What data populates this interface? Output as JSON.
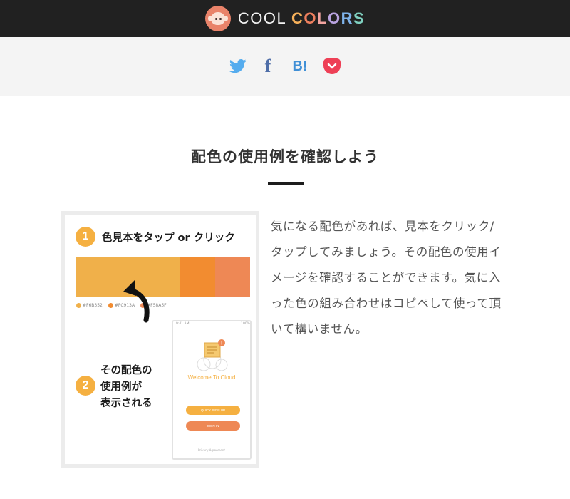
{
  "header": {
    "logo_word_1": "COOL",
    "logo_word_2_letters": [
      "C",
      "O",
      "L",
      "O",
      "R",
      "S"
    ],
    "logo_word_2_colors": [
      "#f6b05a",
      "#ee7f5e",
      "#f2a4a0",
      "#b9a3e0",
      "#7fb3ea",
      "#7fd0c0"
    ],
    "bg_color": "#212121",
    "logo_icon": "monkey-face-icon"
  },
  "share": {
    "items": [
      {
        "name": "twitter",
        "icon": "twitter-bird-icon",
        "color": "#55acee"
      },
      {
        "name": "facebook",
        "icon": "facebook-f-icon",
        "label": "f",
        "color": "#4f6ea8"
      },
      {
        "name": "hatena",
        "icon": "hatena-bookmark-icon",
        "label": "B!",
        "color": "#3f8fd6"
      },
      {
        "name": "pocket",
        "icon": "pocket-icon",
        "color": "#ee4056"
      }
    ]
  },
  "section": {
    "title": "配色の使用例を確認しよう",
    "description": "気になる配色があれば、見本をクリック/タップしてみましょう。その配色の使用イメージを確認することができます。気に入った色の組み合わせはコピペして使って頂いて構いません。"
  },
  "instruction": {
    "step1_number": "1",
    "step1_text": "色見本をタップ or クリック",
    "step2_number": "2",
    "step2_lines": [
      "その配色の",
      "使用例が",
      "表示される"
    ],
    "swatch_colors": [
      "#f0b04a",
      "#f28c30",
      "#ee8855"
    ],
    "swatch_codes": [
      "#F6B352",
      "#FC913A",
      "#F58A5F"
    ],
    "phone": {
      "time": "9:41 AM",
      "battery": "100%",
      "welcome": "Welcome To Cloud",
      "button_1": "QUICK SIGN UP",
      "button_2": "SIGN IN",
      "footer": "Privacy Agreement"
    }
  }
}
